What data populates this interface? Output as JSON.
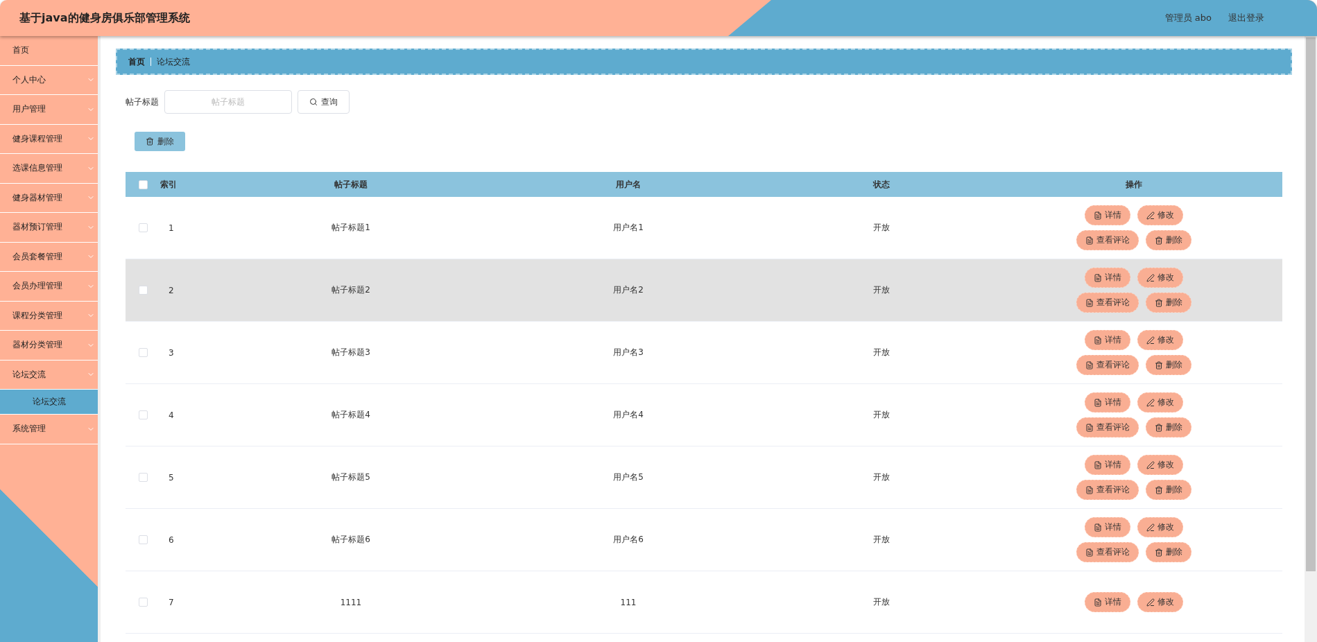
{
  "header": {
    "title": "基于java的健身房俱乐部管理系统",
    "user": "管理员 abo",
    "logout": "退出登录"
  },
  "sidebar": {
    "items": [
      {
        "label": "首页",
        "kind": "link"
      },
      {
        "label": "个人中心",
        "kind": "menu"
      },
      {
        "label": "用户管理",
        "kind": "menu"
      },
      {
        "label": "健身课程管理",
        "kind": "menu"
      },
      {
        "label": "选课信息管理",
        "kind": "menu"
      },
      {
        "label": "健身器材管理",
        "kind": "menu"
      },
      {
        "label": "器材预订管理",
        "kind": "menu"
      },
      {
        "label": "会员套餐管理",
        "kind": "menu"
      },
      {
        "label": "会员办理管理",
        "kind": "menu"
      },
      {
        "label": "课程分类管理",
        "kind": "menu"
      },
      {
        "label": "器材分类管理",
        "kind": "menu"
      },
      {
        "label": "论坛交流",
        "kind": "menu",
        "children": [
          {
            "label": "论坛交流",
            "selected": true
          }
        ]
      },
      {
        "label": "系统管理",
        "kind": "menu"
      }
    ]
  },
  "breadcrumb": [
    "首页",
    "论坛交流"
  ],
  "search": {
    "label": "帖子标题",
    "placeholder": "帖子标题",
    "button": "查询"
  },
  "delete_button": "删除",
  "table": {
    "all_checked": false,
    "columns": [
      "索引",
      "帖子标题",
      "用户名",
      "状态",
      "操作"
    ],
    "rows": [
      {
        "checked": false,
        "hovered": false,
        "index": "1",
        "title": "帖子标题1",
        "user": "用户名1",
        "status": "开放",
        "actions": [
          {
            "kind": "detail",
            "label": "详情"
          },
          {
            "kind": "edit",
            "label": "修改"
          },
          {
            "kind": "comments",
            "label": "查看评论"
          },
          {
            "kind": "delete",
            "label": "删除"
          }
        ]
      },
      {
        "checked": false,
        "hovered": true,
        "index": "2",
        "title": "帖子标题2",
        "user": "用户名2",
        "status": "开放",
        "actions": [
          {
            "kind": "detail",
            "label": "详情"
          },
          {
            "kind": "edit",
            "label": "修改"
          },
          {
            "kind": "comments",
            "label": "查看评论"
          },
          {
            "kind": "delete",
            "label": "删除"
          }
        ]
      },
      {
        "checked": false,
        "hovered": false,
        "index": "3",
        "title": "帖子标题3",
        "user": "用户名3",
        "status": "开放",
        "actions": [
          {
            "kind": "detail",
            "label": "详情"
          },
          {
            "kind": "edit",
            "label": "修改"
          },
          {
            "kind": "comments",
            "label": "查看评论"
          },
          {
            "kind": "delete",
            "label": "删除"
          }
        ]
      },
      {
        "checked": false,
        "hovered": false,
        "index": "4",
        "title": "帖子标题4",
        "user": "用户名4",
        "status": "开放",
        "actions": [
          {
            "kind": "detail",
            "label": "详情"
          },
          {
            "kind": "edit",
            "label": "修改"
          },
          {
            "kind": "comments",
            "label": "查看评论"
          },
          {
            "kind": "delete",
            "label": "删除"
          }
        ]
      },
      {
        "checked": false,
        "hovered": false,
        "index": "5",
        "title": "帖子标题5",
        "user": "用户名5",
        "status": "开放",
        "actions": [
          {
            "kind": "detail",
            "label": "详情"
          },
          {
            "kind": "edit",
            "label": "修改"
          },
          {
            "kind": "comments",
            "label": "查看评论"
          },
          {
            "kind": "delete",
            "label": "删除"
          }
        ]
      },
      {
        "checked": false,
        "hovered": false,
        "index": "6",
        "title": "帖子标题6",
        "user": "用户名6",
        "status": "开放",
        "actions": [
          {
            "kind": "detail",
            "label": "详情"
          },
          {
            "kind": "edit",
            "label": "修改"
          },
          {
            "kind": "comments",
            "label": "查看评论"
          },
          {
            "kind": "delete",
            "label": "删除"
          }
        ]
      },
      {
        "checked": false,
        "hovered": false,
        "index": "7",
        "title": "1111",
        "user": "111",
        "status": "开放",
        "actions": [
          {
            "kind": "detail",
            "label": "详情"
          },
          {
            "kind": "edit",
            "label": "修改"
          }
        ]
      }
    ]
  }
}
